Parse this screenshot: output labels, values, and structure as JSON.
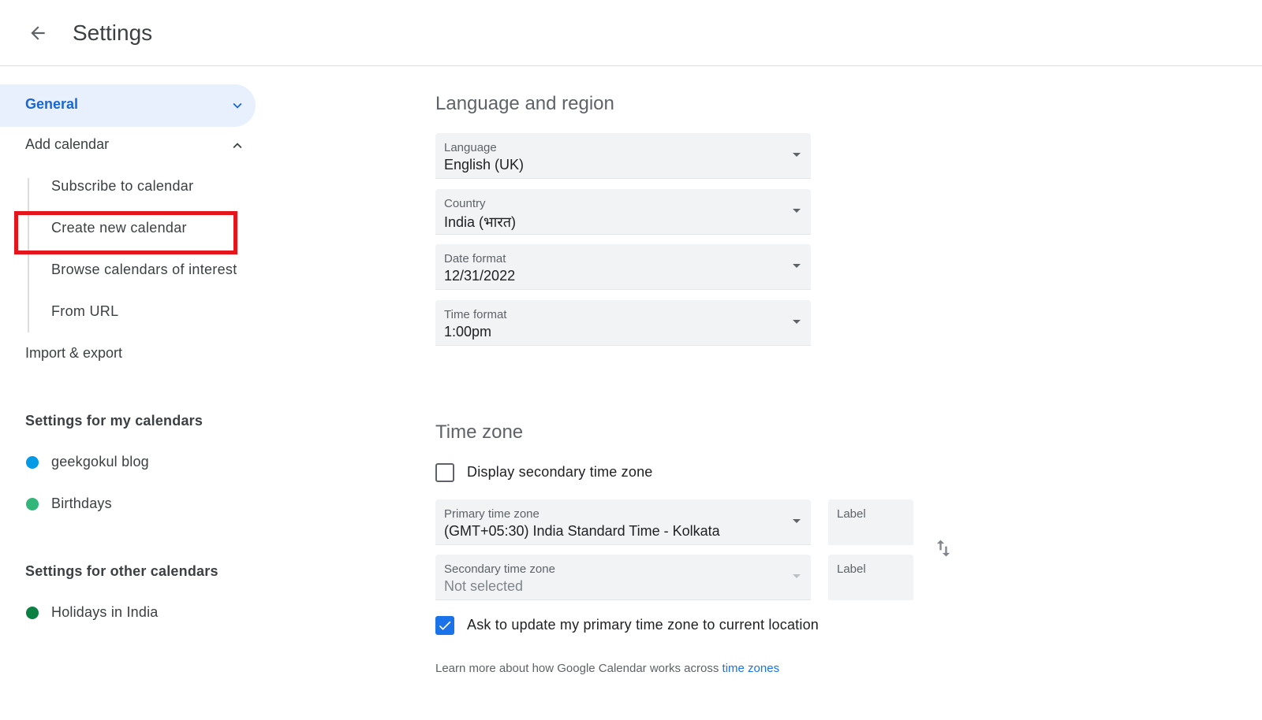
{
  "header": {
    "title": "Settings",
    "back_icon": "arrow-left-icon"
  },
  "sidebar": {
    "general": {
      "label": "General"
    },
    "add_calendar": {
      "label": "Add calendar",
      "subitems": [
        {
          "label": "Subscribe to calendar"
        },
        {
          "label": "Create new calendar"
        },
        {
          "label": "Browse calendars of interest"
        },
        {
          "label": "From URL"
        }
      ]
    },
    "import_export": {
      "label": "Import & export"
    },
    "my_calendars": {
      "heading": "Settings for my calendars",
      "items": [
        {
          "label": "geekgokul blog",
          "color": "#039be5"
        },
        {
          "label": "Birthdays",
          "color": "#33b679"
        }
      ]
    },
    "other_calendars": {
      "heading": "Settings for other calendars",
      "items": [
        {
          "label": "Holidays in India",
          "color": "#0b8043"
        }
      ]
    }
  },
  "language_region": {
    "title": "Language and region",
    "fields": [
      {
        "label": "Language",
        "value": "English (UK)"
      },
      {
        "label": "Country",
        "value": "India (भारत)"
      },
      {
        "label": "Date format",
        "value": "12/31/2022"
      },
      {
        "label": "Time format",
        "value": "1:00pm"
      }
    ]
  },
  "time_zone": {
    "title": "Time zone",
    "display_secondary": {
      "label": "Display secondary time zone",
      "checked": false
    },
    "primary": {
      "label": "Primary time zone",
      "value": "(GMT+05:30) India Standard Time - Kolkata"
    },
    "secondary": {
      "label": "Secondary time zone",
      "value": "Not selected"
    },
    "label_placeholder": "Label",
    "ask_update": {
      "label": "Ask to update my primary time zone to current location",
      "checked": true
    },
    "learn_more": {
      "text": "Learn more about how Google Calendar works across ",
      "link": "time zones"
    }
  },
  "colors": {
    "accent": "#1a73e8",
    "highlight": "#e5161b",
    "selected_bg": "#e8f0fe"
  }
}
